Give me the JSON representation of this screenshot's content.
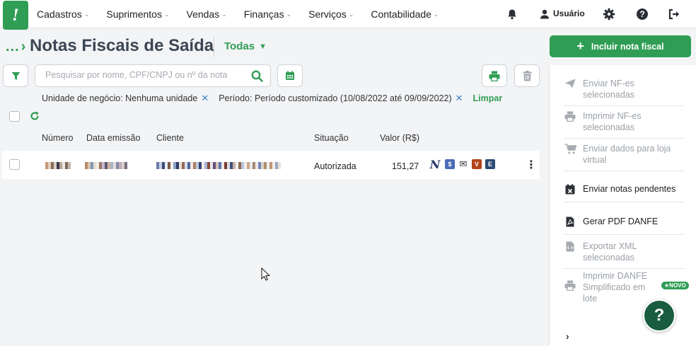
{
  "nav": {
    "items": [
      {
        "label": "Cadastros"
      },
      {
        "label": "Suprimentos"
      },
      {
        "label": "Vendas"
      },
      {
        "label": "Finanças"
      },
      {
        "label": "Serviços"
      },
      {
        "label": "Contabilidade"
      }
    ],
    "user_label": "Usuário"
  },
  "header": {
    "breadcrumb": "...",
    "title": "Notas Fiscais de Saída",
    "filter_value": "Todas"
  },
  "toolbar": {
    "search_placeholder": "Pesquisar por nome, CPF/CNPJ ou nº da nota",
    "search_value": ""
  },
  "filters": {
    "chips": [
      {
        "label": "Unidade de negócio: Nenhuma unidade"
      },
      {
        "label": "Período: Período customizado (10/08/2022 até 09/09/2022)"
      }
    ],
    "clear_label": "Limpar"
  },
  "table": {
    "columns": [
      "Número",
      "Data emissão",
      "Cliente",
      "Situação",
      "Valor (R$)"
    ],
    "rows": [
      {
        "situacao": "Autorizada",
        "valor": "151,27",
        "badges": [
          "N",
          "$",
          "✉",
          "V",
          "E"
        ]
      }
    ]
  },
  "sidebar": {
    "primary_button": "Incluir nota fiscal",
    "items": [
      {
        "label": "Enviar NF-es selecionadas",
        "enabled": false,
        "icon": "send-icon"
      },
      {
        "label": "Imprimir NF-es selecionadas",
        "enabled": false,
        "icon": "printer-icon"
      },
      {
        "label": "Enviar dados para loja virtual",
        "enabled": false,
        "icon": "cart-icon"
      },
      {
        "label": "Enviar notas pendentes",
        "enabled": true,
        "icon": "calendar-x-icon"
      },
      {
        "label": "Gerar PDF DANFE",
        "enabled": true,
        "icon": "pdf-file-icon"
      },
      {
        "label": "Exportar XML selecionadas",
        "enabled": false,
        "icon": "code-file-icon"
      },
      {
        "label": "Imprimir DANFE Simplificado em lote",
        "enabled": false,
        "icon": "printer-icon"
      }
    ],
    "new_badge": "NOVO",
    "help_label": "?"
  },
  "colors": {
    "brand": "#2f9e54",
    "brand_dark": "#1a5c3f",
    "heading": "#3b4654",
    "chip_remove": "#3b82c4"
  }
}
